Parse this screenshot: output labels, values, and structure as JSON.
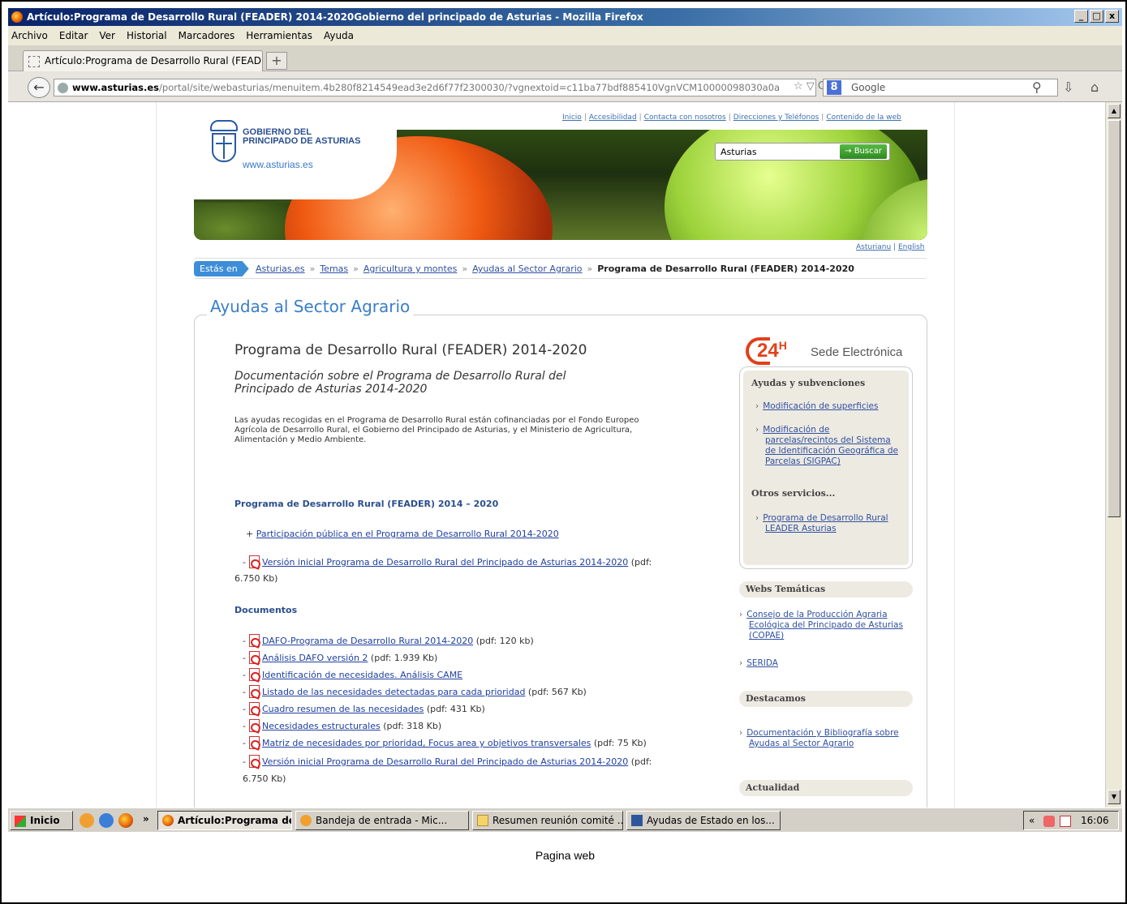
{
  "window": {
    "title": "Artículo:Programa de Desarrollo Rural (FEADER) 2014-2020Gobierno del principado de Asturias - Mozilla Firefox",
    "controls": [
      "_",
      "□",
      "x"
    ]
  },
  "menu": [
    "Archivo",
    "Editar",
    "Ver",
    "Historial",
    "Marcadores",
    "Herramientas",
    "Ayuda"
  ],
  "tab": {
    "title": "Artículo:Programa de Desarrollo Rural (FEAD...",
    "new_tab": "+"
  },
  "nav": {
    "url_domain": "www.asturias.es",
    "url_rest": "/portal/site/webasturias/menuitem.4b280f8214549ead3e2d6f77f2300030/?vgnextoid=c11ba77bdf885410VgnVCM10000098030a0a",
    "search_engine": "Google",
    "url_icons": "☆ ▽ C"
  },
  "page": {
    "toplinks": [
      "Inicio",
      "Accesibilidad",
      "Contacta con nosotros",
      "Direcciones y Teléfonos",
      "Contenido de la web"
    ],
    "logo": {
      "line1": "GOBIERNO DEL",
      "line2": "PRINCIPADO DE ASTURIAS",
      "url": "www.asturias.es"
    },
    "search": {
      "value": "Asturias",
      "button": "→ Buscar"
    },
    "lang_links": [
      "Asturianu",
      "English"
    ],
    "breadcrumb": {
      "label": "Estás en",
      "items": [
        "Asturias.es",
        "Temas",
        "Agricultura y montes",
        "Ayudas al Sector Agrario"
      ],
      "current": "Programa de Desarrollo Rural (FEADER) 2014-2020"
    },
    "section_title": "Ayudas al Sector Agrario",
    "main": {
      "title": "Programa de Desarrollo Rural (FEADER) 2014-2020",
      "subtitle": "Documentación sobre el Programa de Desarrollo Rural del Principado de Asturias 2014-2020",
      "intro": "Las ayudas recogidas en el Programa de Desarrollo Rural están cofinanciadas por el Fondo Europeo Agrícola de Desarrollo Rural, el Gobierno del Principado de Asturias, y el Ministerio de Agricultura, Alimentación y Medio Ambiente.",
      "prog_heading": "Programa de Desarrollo Rural (FEADER) 2014 – 2020",
      "prog_item1_prefix": "+ ",
      "prog_item1_link": "Participación pública en el Programa de Desarrollo Rural 2014-2020",
      "prog_item2_link": "Versión inicial Programa de Desarrollo Rural del Principado de Asturias 2014-2020",
      "prog_item2_suffix": " (pdf: 6.750 Kb)",
      "docs_heading": "Documentos",
      "docs": [
        {
          "link": "DAFO-Programa de Desarrollo Rural 2014-2020",
          "suffix": " (pdf: 120 kb)"
        },
        {
          "link": "Análisis DAFO versión 2",
          "suffix": " (pdf: 1.939 Kb)"
        },
        {
          "link": "Identificación de necesidades. Análisis CAME",
          "suffix": ""
        },
        {
          "link": "Listado de las necesidades detectadas para cada prioridad",
          "suffix": " (pdf: 567 Kb)"
        },
        {
          "link": "Cuadro resumen de las necesidades",
          "suffix": " (pdf: 431 Kb)"
        },
        {
          "link": "Necesidades estructurales",
          "suffix": " (pdf: 318 Kb)"
        },
        {
          "link": "Matriz de necesidades por prioridad, Focus area y objetivos transversales",
          "suffix": " (pdf: 75 Kb)"
        },
        {
          "link": "Versión inicial Programa de Desarrollo Rural del Principado de Asturias 2014-2020",
          "suffix": " (pdf: 6.750 Kb)"
        }
      ]
    },
    "sidebar": {
      "sede_24": "24",
      "sede_h": "H",
      "sede_text": "Sede Electrónica",
      "ayudas_heading": "Ayudas y subvenciones",
      "ayudas_links": [
        "Modificación de superficies",
        "Modificación de parcelas/recintos del Sistema de Identificación Geográfica de Parcelas (SIGPAC)"
      ],
      "otros_heading": "Otros servicios...",
      "otros_links": [
        "Programa de Desarrollo Rural LEADER Asturias"
      ],
      "webs_heading": "Webs Temáticas",
      "webs_links": [
        "Consejo de la Producción Agraria Ecológica del Principado de Asturias (COPAE)",
        "SERIDA"
      ],
      "destacamos_heading": "Destacamos",
      "destacamos_links": [
        "Documentación y Bibliografía sobre Ayudas al Sector Agrario"
      ],
      "actualidad_heading": "Actualidad"
    }
  },
  "taskbar": {
    "start": "Inicio",
    "overflow": "»",
    "tasks": [
      "Artículo:Programa de ...",
      "Bandeja de entrada - Mic...",
      "Resumen reunión comité ...",
      "Ayudas de Estado en los..."
    ],
    "tray_arrows": "«",
    "time": "16:06"
  },
  "caption": "Pagina web",
  "colors": {
    "link": "#2040a0",
    "accent_blue": "#3d8ed8",
    "heading_blue": "#2a4f8e",
    "sede_red": "#e2401a"
  }
}
